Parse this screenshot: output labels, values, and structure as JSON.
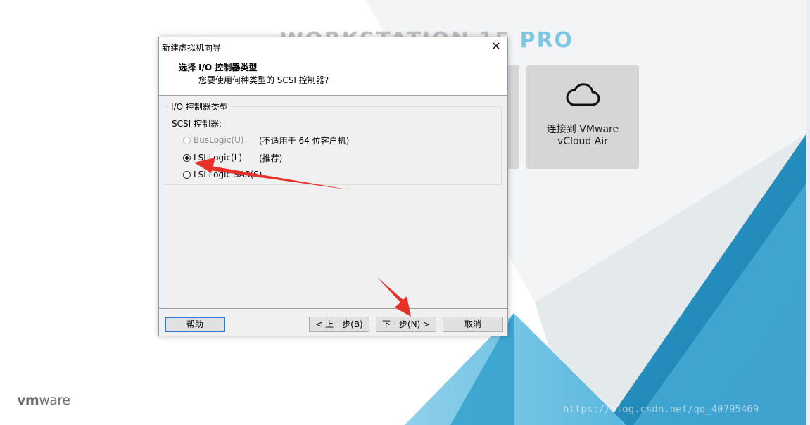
{
  "background": {
    "title_text": "WORKSTATION 15",
    "title_suffix": "PRO",
    "tile": {
      "line1": "连接到 VMware",
      "line2": "vCloud Air",
      "icon": "cloud-icon"
    },
    "brand": {
      "bold": "vm",
      "rest": "ware"
    },
    "watermark": "https://blog.csdn.net/qq_40795469"
  },
  "dialog": {
    "window_title": "新建虚拟机向导",
    "close_glyph": "✕",
    "header_title": "选择 I/O 控制器类型",
    "header_subtitle": "您要使用何种类型的 SCSI 控制器?",
    "group_legend": "I/O 控制器类型",
    "scsi_label": "SCSI 控制器:",
    "options": [
      {
        "label": "BusLogic(U)",
        "note": "(不适用于 64 位客户机)",
        "selected": false,
        "disabled": true
      },
      {
        "label": "LSI Logic(L)",
        "note": "(推荐)",
        "selected": true,
        "disabled": false
      },
      {
        "label": "LSI Logic SAS(S)",
        "note": "",
        "selected": false,
        "disabled": false
      }
    ],
    "buttons": {
      "help": "帮助",
      "prev": "< 上一步(B)",
      "next": "下一步(N) >",
      "cancel": "取消"
    }
  },
  "colors": {
    "accent_blue": "#2a9bc9",
    "arrow_red": "#e8302a",
    "button_focus": "#2a7bd1"
  }
}
